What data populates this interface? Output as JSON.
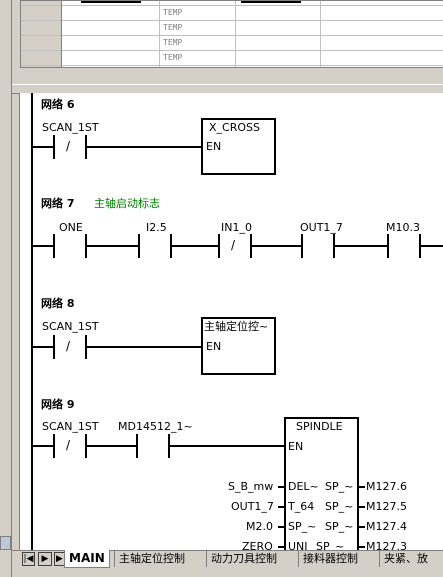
{
  "vartable": {
    "rows": [
      "TEMP",
      "TEMP",
      "TEMP",
      "TEMP"
    ]
  },
  "networks": [
    {
      "id": "net6",
      "title": "网络 6",
      "comment": "",
      "contacts": [
        "SCAN_1ST"
      ],
      "box_title": "X_CROSS",
      "box_en": "EN"
    },
    {
      "id": "net7",
      "title": "网络 7",
      "comment": "主轴启动标志",
      "contacts": [
        "ONE",
        "I2.5",
        "IN1_0",
        "OUT1_7",
        "M10.3"
      ]
    },
    {
      "id": "net8",
      "title": "网络 8",
      "comment": "",
      "contacts": [
        "SCAN_1ST"
      ],
      "box_title": "主轴定位控~",
      "box_en": "EN"
    },
    {
      "id": "net9",
      "title": "网络 9",
      "comment": "",
      "contacts": [
        "SCAN_1ST",
        "MD14512_1~"
      ],
      "box_title": "SPINDLE",
      "box_en": "EN",
      "inputs": [
        {
          "left": "S_B_mw",
          "pin": "DEL~"
        },
        {
          "left": "OUT1_7",
          "pin": "T_64"
        },
        {
          "left": "M2.0",
          "pin": "SP_~"
        },
        {
          "left": "ZERO",
          "pin": "UNI"
        }
      ],
      "outputs": [
        {
          "pin": "SP_~",
          "right": "M127.6"
        },
        {
          "pin": "SP_~",
          "right": "M127.5"
        },
        {
          "pin": "SP_~",
          "right": "M127.4"
        },
        {
          "pin": "SP_~",
          "right": "M127.3"
        }
      ]
    }
  ],
  "contact_symbols": {
    "negated": "/"
  },
  "tabs": [
    "MAIN",
    "主轴定位控制",
    "动力刀具控制",
    "接料器控制",
    "夹紧、放"
  ],
  "colors": {
    "comment": "#008000",
    "selection": "#0a246a"
  }
}
